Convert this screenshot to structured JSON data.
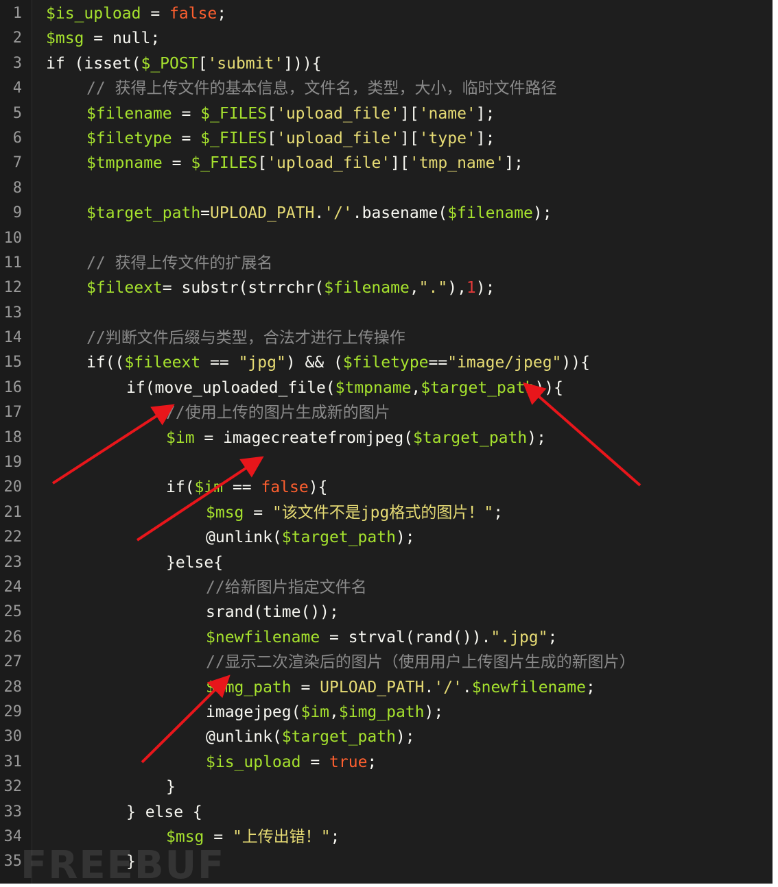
{
  "editor": {
    "lines": [
      {
        "n": "1",
        "indent": 0,
        "tokens": [
          {
            "t": "$is_upload",
            "c": "var"
          },
          {
            "t": " = ",
            "c": "plain"
          },
          {
            "t": "false",
            "c": "bool"
          },
          {
            "t": ";",
            "c": "plain"
          }
        ]
      },
      {
        "n": "2",
        "indent": 0,
        "tokens": [
          {
            "t": "$msg",
            "c": "var"
          },
          {
            "t": " = ",
            "c": "plain"
          },
          {
            "t": "null",
            "c": "plain"
          },
          {
            "t": ";",
            "c": "plain"
          }
        ]
      },
      {
        "n": "3",
        "indent": 0,
        "tokens": [
          {
            "t": "if (isset(",
            "c": "plain"
          },
          {
            "t": "$_POST",
            "c": "var"
          },
          {
            "t": "[",
            "c": "plain"
          },
          {
            "t": "'submit'",
            "c": "str"
          },
          {
            "t": "])){",
            "c": "plain"
          }
        ]
      },
      {
        "n": "4",
        "indent": 1,
        "tokens": [
          {
            "t": "// 获得上传文件的基本信息，文件名，类型，大小，临时文件路径",
            "c": "cmt"
          }
        ]
      },
      {
        "n": "5",
        "indent": 1,
        "tokens": [
          {
            "t": "$filename",
            "c": "var"
          },
          {
            "t": " = ",
            "c": "plain"
          },
          {
            "t": "$_FILES",
            "c": "var"
          },
          {
            "t": "[",
            "c": "plain"
          },
          {
            "t": "'upload_file'",
            "c": "str"
          },
          {
            "t": "][",
            "c": "plain"
          },
          {
            "t": "'name'",
            "c": "str"
          },
          {
            "t": "];",
            "c": "plain"
          }
        ]
      },
      {
        "n": "6",
        "indent": 1,
        "tokens": [
          {
            "t": "$filetype",
            "c": "var"
          },
          {
            "t": " = ",
            "c": "plain"
          },
          {
            "t": "$_FILES",
            "c": "var"
          },
          {
            "t": "[",
            "c": "plain"
          },
          {
            "t": "'upload_file'",
            "c": "str"
          },
          {
            "t": "][",
            "c": "plain"
          },
          {
            "t": "'type'",
            "c": "str"
          },
          {
            "t": "];",
            "c": "plain"
          }
        ]
      },
      {
        "n": "7",
        "indent": 1,
        "tokens": [
          {
            "t": "$tmpname",
            "c": "var"
          },
          {
            "t": " = ",
            "c": "plain"
          },
          {
            "t": "$_FILES",
            "c": "var"
          },
          {
            "t": "[",
            "c": "plain"
          },
          {
            "t": "'upload_file'",
            "c": "str"
          },
          {
            "t": "][",
            "c": "plain"
          },
          {
            "t": "'tmp_name'",
            "c": "str"
          },
          {
            "t": "];",
            "c": "plain"
          }
        ]
      },
      {
        "n": "8",
        "indent": 1,
        "tokens": []
      },
      {
        "n": "9",
        "indent": 1,
        "tokens": [
          {
            "t": "$target_path",
            "c": "var"
          },
          {
            "t": "=",
            "c": "plain"
          },
          {
            "t": "UPLOAD_PATH",
            "c": "const"
          },
          {
            "t": ".",
            "c": "plain"
          },
          {
            "t": "'/'",
            "c": "str"
          },
          {
            "t": ".basename(",
            "c": "plain"
          },
          {
            "t": "$filename",
            "c": "var"
          },
          {
            "t": ");",
            "c": "plain"
          }
        ]
      },
      {
        "n": "10",
        "indent": 1,
        "tokens": []
      },
      {
        "n": "11",
        "indent": 1,
        "tokens": [
          {
            "t": "// 获得上传文件的扩展名",
            "c": "cmt"
          }
        ]
      },
      {
        "n": "12",
        "indent": 1,
        "tokens": [
          {
            "t": "$fileext",
            "c": "var"
          },
          {
            "t": "= substr(strrchr(",
            "c": "plain"
          },
          {
            "t": "$filename",
            "c": "var"
          },
          {
            "t": ",",
            "c": "plain"
          },
          {
            "t": "\".\"",
            "c": "str"
          },
          {
            "t": "),",
            "c": "plain"
          },
          {
            "t": "1",
            "c": "num"
          },
          {
            "t": ");",
            "c": "plain"
          }
        ]
      },
      {
        "n": "13",
        "indent": 1,
        "tokens": []
      },
      {
        "n": "14",
        "indent": 1,
        "tokens": [
          {
            "t": "//判断文件后缀与类型，合法才进行上传操作",
            "c": "cmt"
          }
        ]
      },
      {
        "n": "15",
        "indent": 1,
        "tokens": [
          {
            "t": "if((",
            "c": "plain"
          },
          {
            "t": "$fileext",
            "c": "var"
          },
          {
            "t": " == ",
            "c": "plain"
          },
          {
            "t": "\"jpg\"",
            "c": "str"
          },
          {
            "t": ") && (",
            "c": "plain"
          },
          {
            "t": "$filetype",
            "c": "var"
          },
          {
            "t": "==",
            "c": "plain"
          },
          {
            "t": "\"image/jpeg\"",
            "c": "str"
          },
          {
            "t": ")){",
            "c": "plain"
          }
        ]
      },
      {
        "n": "16",
        "indent": 2,
        "tokens": [
          {
            "t": "if(move_uploaded_file(",
            "c": "plain"
          },
          {
            "t": "$tmpname",
            "c": "var"
          },
          {
            "t": ",",
            "c": "plain"
          },
          {
            "t": "$target_path",
            "c": "var"
          },
          {
            "t": ")){",
            "c": "plain"
          }
        ]
      },
      {
        "n": "17",
        "indent": 3,
        "tokens": [
          {
            "t": "//使用上传的图片生成新的图片",
            "c": "cmt"
          }
        ]
      },
      {
        "n": "18",
        "indent": 3,
        "tokens": [
          {
            "t": "$im",
            "c": "var"
          },
          {
            "t": " = imagecreatefromjpeg(",
            "c": "plain"
          },
          {
            "t": "$target_path",
            "c": "var"
          },
          {
            "t": ");",
            "c": "plain"
          }
        ]
      },
      {
        "n": "19",
        "indent": 3,
        "tokens": []
      },
      {
        "n": "20",
        "indent": 3,
        "tokens": [
          {
            "t": "if(",
            "c": "plain"
          },
          {
            "t": "$im",
            "c": "var"
          },
          {
            "t": " == ",
            "c": "plain"
          },
          {
            "t": "false",
            "c": "bool"
          },
          {
            "t": "){",
            "c": "plain"
          }
        ]
      },
      {
        "n": "21",
        "indent": 4,
        "tokens": [
          {
            "t": "$msg",
            "c": "var"
          },
          {
            "t": " = ",
            "c": "plain"
          },
          {
            "t": "\"该文件不是jpg格式的图片！\"",
            "c": "str"
          },
          {
            "t": ";",
            "c": "plain"
          }
        ]
      },
      {
        "n": "22",
        "indent": 4,
        "tokens": [
          {
            "t": "@unlink(",
            "c": "plain"
          },
          {
            "t": "$target_path",
            "c": "var"
          },
          {
            "t": ");",
            "c": "plain"
          }
        ]
      },
      {
        "n": "23",
        "indent": 3,
        "tokens": [
          {
            "t": "}else{",
            "c": "plain"
          }
        ]
      },
      {
        "n": "24",
        "indent": 4,
        "tokens": [
          {
            "t": "//给新图片指定文件名",
            "c": "cmt"
          }
        ]
      },
      {
        "n": "25",
        "indent": 4,
        "tokens": [
          {
            "t": "srand(time());",
            "c": "plain"
          }
        ]
      },
      {
        "n": "26",
        "indent": 4,
        "tokens": [
          {
            "t": "$newfilename",
            "c": "var"
          },
          {
            "t": " = strval(rand()).",
            "c": "plain"
          },
          {
            "t": "\".jpg\"",
            "c": "str"
          },
          {
            "t": ";",
            "c": "plain"
          }
        ]
      },
      {
        "n": "27",
        "indent": 4,
        "tokens": [
          {
            "t": "//显示二次渲染后的图片（使用用户上传图片生成的新图片）",
            "c": "cmt"
          }
        ]
      },
      {
        "n": "28",
        "indent": 4,
        "tokens": [
          {
            "t": "$img_path",
            "c": "var"
          },
          {
            "t": " = ",
            "c": "plain"
          },
          {
            "t": "UPLOAD_PATH",
            "c": "const"
          },
          {
            "t": ".",
            "c": "plain"
          },
          {
            "t": "'/'",
            "c": "str"
          },
          {
            "t": ".",
            "c": "plain"
          },
          {
            "t": "$newfilename",
            "c": "var"
          },
          {
            "t": ";",
            "c": "plain"
          }
        ]
      },
      {
        "n": "29",
        "indent": 4,
        "tokens": [
          {
            "t": "imagejpeg(",
            "c": "plain"
          },
          {
            "t": "$im",
            "c": "var"
          },
          {
            "t": ",",
            "c": "plain"
          },
          {
            "t": "$img_path",
            "c": "var"
          },
          {
            "t": ");",
            "c": "plain"
          }
        ]
      },
      {
        "n": "30",
        "indent": 4,
        "tokens": [
          {
            "t": "@unlink(",
            "c": "plain"
          },
          {
            "t": "$target_path",
            "c": "var"
          },
          {
            "t": ");",
            "c": "plain"
          }
        ]
      },
      {
        "n": "31",
        "indent": 4,
        "tokens": [
          {
            "t": "$is_upload",
            "c": "var"
          },
          {
            "t": " = ",
            "c": "plain"
          },
          {
            "t": "true",
            "c": "bool"
          },
          {
            "t": ";",
            "c": "plain"
          }
        ]
      },
      {
        "n": "32",
        "indent": 3,
        "tokens": [
          {
            "t": "}",
            "c": "plain"
          }
        ]
      },
      {
        "n": "33",
        "indent": 2,
        "tokens": [
          {
            "t": "} else {",
            "c": "plain"
          }
        ]
      },
      {
        "n": "34",
        "indent": 3,
        "tokens": [
          {
            "t": "$msg",
            "c": "var"
          },
          {
            "t": " = ",
            "c": "plain"
          },
          {
            "t": "\"上传出错！\"",
            "c": "str"
          },
          {
            "t": ";",
            "c": "plain"
          }
        ]
      },
      {
        "n": "35",
        "indent": 2,
        "tokens": [
          {
            "t": "}",
            "c": "plain"
          }
        ]
      }
    ]
  },
  "watermark": "FREEBUF",
  "colors": {
    "background": "#1e1e1e",
    "gutter": "#1b1b1b",
    "line_number": "#9a9a9a",
    "variable": "#a6e22e",
    "string": "#e6db74",
    "boolean": "#fd5f2f",
    "comment": "#8a8a8a",
    "number": "#e33a3a",
    "arrow": "#e8161b"
  }
}
